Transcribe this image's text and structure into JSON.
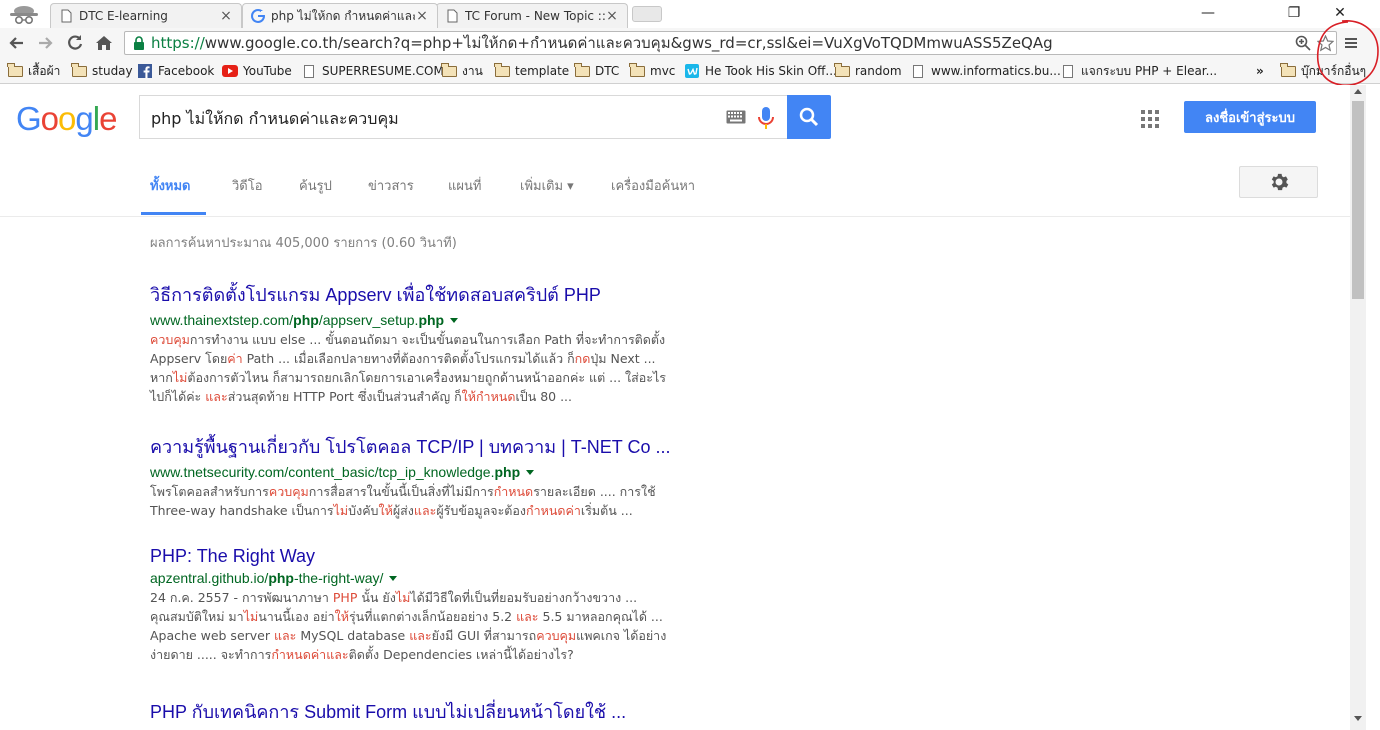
{
  "tabs": [
    {
      "title": "DTC E-learning",
      "active": false
    },
    {
      "title": "php ไม่ให้กด กำหนดค่าและคว",
      "active": true
    },
    {
      "title": "TC Forum - New Topic :: ค",
      "active": false
    }
  ],
  "window_controls": {
    "minimize": "—",
    "restore": "❐",
    "close": "✕"
  },
  "address_bar": {
    "scheme": "https://",
    "rest": "www.google.co.th/search?q=php+ไม่ให้กด+กำหนดค่าและควบคุม&gws_rd=cr,ssl&ei=VuXgVoTQDMmwuASS5ZeQAg"
  },
  "bookmarks": [
    {
      "label": "เสื้อผ้า",
      "icon": "folder-icon"
    },
    {
      "label": "studay",
      "icon": "folder-icon"
    },
    {
      "label": "Facebook",
      "icon": "facebook-icon"
    },
    {
      "label": "YouTube",
      "icon": "youtube-icon"
    },
    {
      "label": "SUPERRESUME.COM",
      "icon": "page-icon"
    },
    {
      "label": "งาน",
      "icon": "folder-icon"
    },
    {
      "label": "template",
      "icon": "folder-icon"
    },
    {
      "label": "DTC",
      "icon": "folder-icon"
    },
    {
      "label": "mvc",
      "icon": "folder-icon"
    },
    {
      "label": "He Took His Skin Off...",
      "icon": "vimeo-icon"
    },
    {
      "label": "random",
      "icon": "folder-icon"
    },
    {
      "label": "www.informatics.bu...",
      "icon": "page-icon"
    },
    {
      "label": "แจกระบบ PHP + Elear...",
      "icon": "page-icon"
    }
  ],
  "bookmarks_overflow": "»",
  "other_bookmarks": "บุ๊กมาร์กอื่นๆ",
  "google": {
    "logo_letters": [
      {
        "ch": "G",
        "color": "#4285f4"
      },
      {
        "ch": "o",
        "color": "#ea4335"
      },
      {
        "ch": "o",
        "color": "#fbbc05"
      },
      {
        "ch": "g",
        "color": "#4285f4"
      },
      {
        "ch": "l",
        "color": "#34a853"
      },
      {
        "ch": "e",
        "color": "#ea4335"
      }
    ],
    "query": "php ไม่ให้กด กำหนดค่าและควบคุม",
    "signin_label": "ลงชื่อเข้าสู่ระบบ",
    "search_tabs": [
      "ทั้งหมด",
      "วิดีโอ",
      "ค้นรูป",
      "ข่าวสาร",
      "แผนที่",
      "เพิ่มเติม ▾",
      "เครื่องมือค้นหา"
    ],
    "stats": "ผลการค้นหาประมาณ 405,000 รายการ (0.60 วินาที)"
  },
  "results": [
    {
      "title": "วิธีการติดตั้งโปรแกรม Appserv เพื่อใช้ทดสอบสคริปต์ PHP",
      "url_parts": [
        [
          "www.thainextstep.com/",
          false
        ],
        [
          "php",
          true
        ],
        [
          "/appserv_setup.",
          false
        ],
        [
          "php",
          true
        ]
      ],
      "snippet_lines": [
        [
          [
            "ควบคุม",
            true
          ],
          [
            "การทำงาน แบบ else ... ขั้นตอนถัดมา จะเป็นขั้นตอนในการเลือก Path ที่จะทำการติดตั้ง",
            false
          ]
        ],
        [
          [
            "Appserv โดย",
            false
          ],
          [
            "ค่า",
            true
          ],
          [
            " Path ... เมื่อเลือกปลายทางที่ต้องการติดตั้งโปรแกรมได้แล้ว ก็",
            false
          ],
          [
            "กด",
            true
          ],
          [
            "ปุ่ม Next ...",
            false
          ]
        ],
        [
          [
            "หาก",
            false
          ],
          [
            "ไม่",
            true
          ],
          [
            "ต้องการตัวไหน ก็สามารถยกเลิกโดยการเอาเครื่องหมายถูกด้านหน้าออกค่ะ แต่ ... ใส่อะไร",
            false
          ]
        ],
        [
          [
            "ไปก็ได้ค่ะ ",
            false
          ],
          [
            "และ",
            true
          ],
          [
            "ส่วนสุดท้าย HTTP Port ซึ่งเป็นส่วนสำคัญ ก็",
            false
          ],
          [
            "ให้กำหนด",
            true
          ],
          [
            "เป็น 80 ...",
            false
          ]
        ]
      ]
    },
    {
      "title": "ความรู้พื้นฐานเกี่ยวกับ โปรโตคอล TCP/IP | บทความ | T-NET Co ...",
      "url_parts": [
        [
          "www.tnetsecurity.com/content_basic/tcp_ip_knowledge.",
          false
        ],
        [
          "php",
          true
        ]
      ],
      "snippet_lines": [
        [
          [
            "โพรโตคอลสำหรับการ",
            false
          ],
          [
            "ควบคุม",
            true
          ],
          [
            "การสื่อสารในขั้นนี้เป็นสิ่งที่ไม่มีการ",
            false
          ],
          [
            "กำหนด",
            true
          ],
          [
            "รายละเอียด .... การใช้",
            false
          ]
        ],
        [
          [
            "Three-way handshake เป็นการ",
            false
          ],
          [
            "ไม่",
            true
          ],
          [
            "บังคับ",
            false
          ],
          [
            "ให้",
            true
          ],
          [
            "ผู้ส่ง",
            false
          ],
          [
            "และ",
            true
          ],
          [
            "ผู้รับข้อมูลจะต้อง",
            false
          ],
          [
            "กำหนดค่า",
            true
          ],
          [
            "เริ่มต้น ...",
            false
          ]
        ]
      ]
    },
    {
      "title": "PHP: The Right Way",
      "url_parts": [
        [
          "apzentral.github.io/",
          false
        ],
        [
          "php",
          true
        ],
        [
          "-the-right-way/",
          false
        ]
      ],
      "snippet_lines": [
        [
          [
            "24 ก.ค. 2557 - การพัฒนาภาษา ",
            false
          ],
          [
            "PHP",
            true
          ],
          [
            " นั้น ยัง",
            false
          ],
          [
            "ไม่",
            true
          ],
          [
            "ได้มีวิธีใดที่เป็นที่ยอมรับอย่างกว้างขวาง ...",
            false
          ]
        ],
        [
          [
            "คุณสมบัติใหม่ มา",
            false
          ],
          [
            "ไม่",
            true
          ],
          [
            "นานนี้เอง อย่า",
            false
          ],
          [
            "ให้",
            true
          ],
          [
            "รุ่นที่แตกต่างเล็กน้อยอย่าง 5.2 ",
            false
          ],
          [
            "และ",
            true
          ],
          [
            " 5.5 มาหลอกคุณได้ ...",
            false
          ]
        ],
        [
          [
            "Apache web server ",
            false
          ],
          [
            "และ",
            true
          ],
          [
            " MySQL database ",
            false
          ],
          [
            "และ",
            true
          ],
          [
            "ยังมี GUI ที่สามารถ",
            false
          ],
          [
            "ควบคุม",
            true
          ],
          [
            "แพคเกจ ได้อย่าง",
            false
          ]
        ],
        [
          [
            "ง่ายดาย ..... จะทำการ",
            false
          ],
          [
            "กำหนดค่าและ",
            true
          ],
          [
            "ติดตั้ง Dependencies เหล่านี้ได้อย่างไร?",
            false
          ]
        ]
      ]
    },
    {
      "title": "PHP กับเทคนิคการ Submit Form แบบไม่เปลี่ยนหน้าโดยใช้ ...",
      "url_parts": [],
      "snippet_lines": []
    }
  ]
}
